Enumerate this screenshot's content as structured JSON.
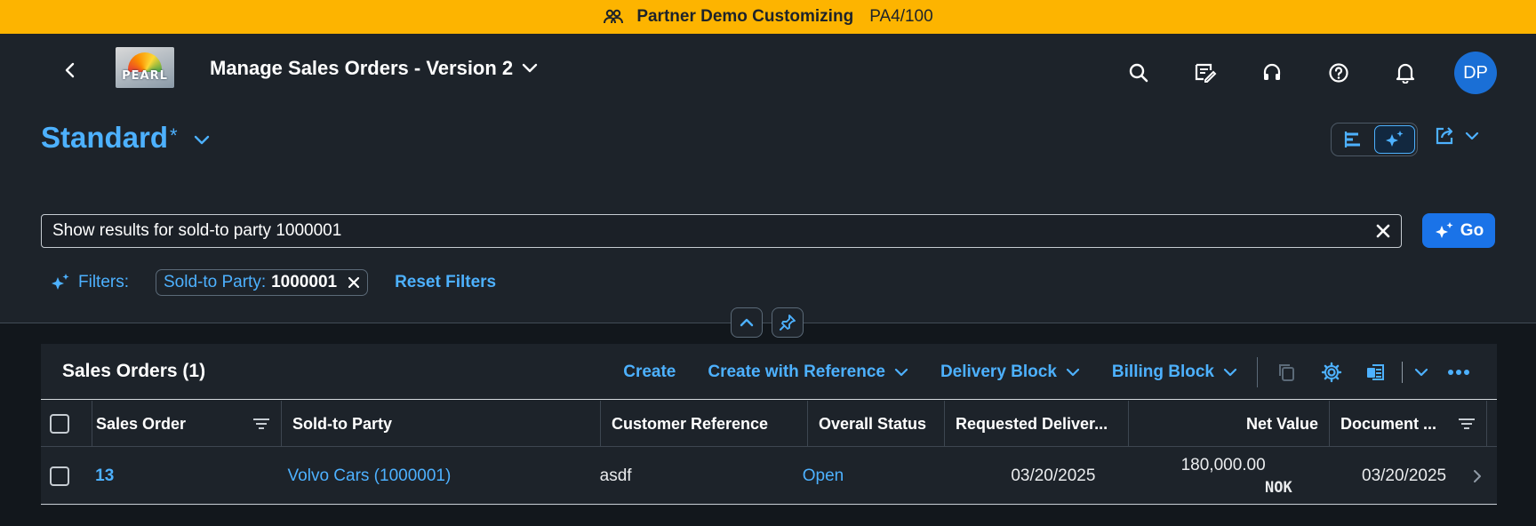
{
  "system_bar": {
    "title": "Partner Demo Customizing",
    "client": "PA4/100",
    "background": "#fdb400"
  },
  "shell": {
    "logo_text": "PEARL",
    "app_title": "Manage Sales Orders - Version 2",
    "avatar_initials": "DP",
    "icons": [
      "back-icon",
      "search-icon",
      "notes-icon",
      "headset-icon",
      "help-icon",
      "bell-icon"
    ]
  },
  "variant": {
    "name": "Standard",
    "modified_marker": "*"
  },
  "search": {
    "value": "Show results for sold-to party 1000001",
    "go_label": "Go"
  },
  "filters": {
    "label": "Filters:",
    "chip_key": "Sold-to Party:",
    "chip_value": "1000001",
    "reset_label": "Reset Filters"
  },
  "table": {
    "title": "Sales Orders (1)",
    "actions": {
      "create": "Create",
      "create_with_reference": "Create with Reference",
      "delivery_block": "Delivery Block",
      "billing_block": "Billing Block"
    },
    "columns": [
      "Sales Order",
      "Sold-to Party",
      "Customer Reference",
      "Overall Status",
      "Requested Deliver...",
      "Net Value",
      "Document ..."
    ],
    "rows": [
      {
        "sales_order": "13",
        "sold_to_party": "Volvo Cars (1000001)",
        "customer_reference": "asdf",
        "overall_status": "Open",
        "requested_delivery": "03/20/2025",
        "net_value": "180,000.00",
        "currency": "NOK",
        "document_date": "03/20/2025"
      }
    ]
  },
  "colors": {
    "accent": "#4db1ff",
    "button": "#1a73e8",
    "page_bg": "#1d232a"
  }
}
